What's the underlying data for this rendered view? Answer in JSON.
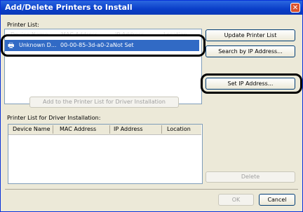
{
  "window": {
    "title": "Add/Delete Printers to Install",
    "close_glyph": "✕"
  },
  "printer_list": {
    "label": "Printer List:",
    "columns": [
      "Device Name",
      "MAC Address",
      "IP Address",
      "Location"
    ],
    "rows": [
      {
        "device": "Unknown D...",
        "mac": "00-00-85-3d-a0-2a",
        "ip": "Not Set"
      }
    ]
  },
  "buttons": {
    "update": "Update Printer List",
    "search_ip": "Search by IP Address...",
    "set_ip": "Set IP Address...",
    "add": "Add to the Printer List for Driver Installation",
    "delete": "Delete",
    "ok": "OK",
    "cancel": "Cancel"
  },
  "driver_list": {
    "label": "Printer List for Driver Installation:",
    "columns": [
      "Device Name",
      "MAC Address",
      "IP Address",
      "Location"
    ]
  },
  "colors": {
    "title_bar": "#0a3ec8",
    "selection": "#316ac5",
    "dialog_bg": "#ece9d8"
  }
}
